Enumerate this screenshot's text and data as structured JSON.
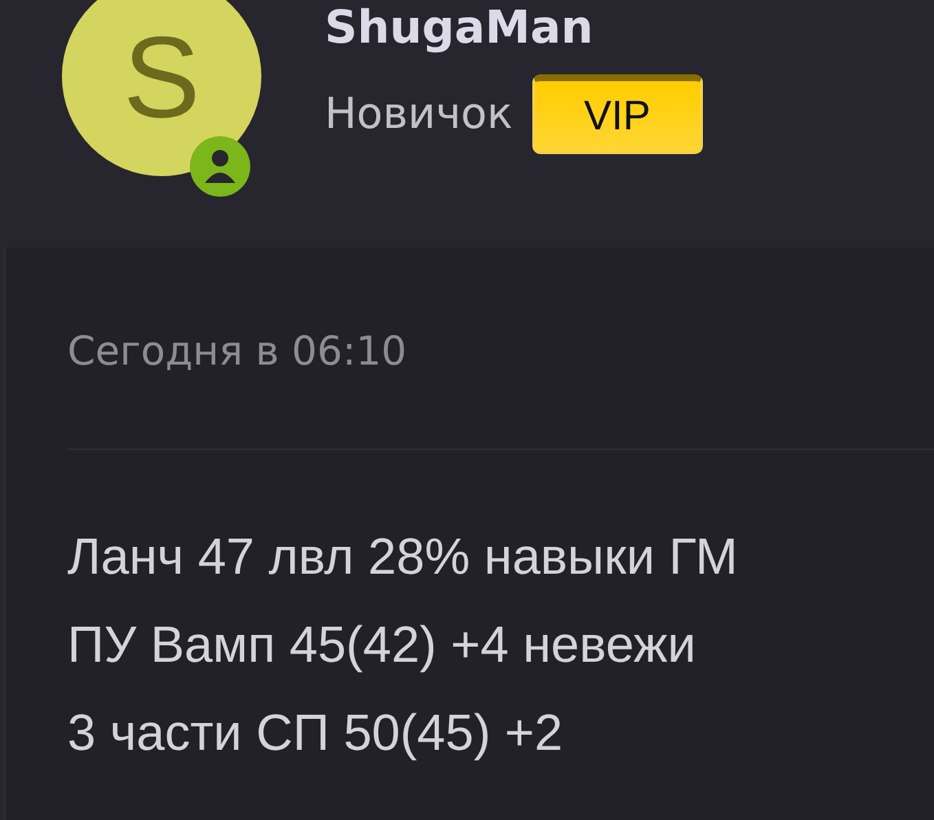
{
  "user": {
    "avatar_letter": "S",
    "online": true,
    "name": "ShugaMan",
    "rank": "Новичок",
    "badge": "VIP"
  },
  "post": {
    "date": "Сегодня в 06:10",
    "lines": [
      "Ланч 47 лвл 28% навыки ГМ",
      "ПУ Вамп 45(42) +4 невежи",
      "3 части СП 50(45) +2"
    ]
  }
}
